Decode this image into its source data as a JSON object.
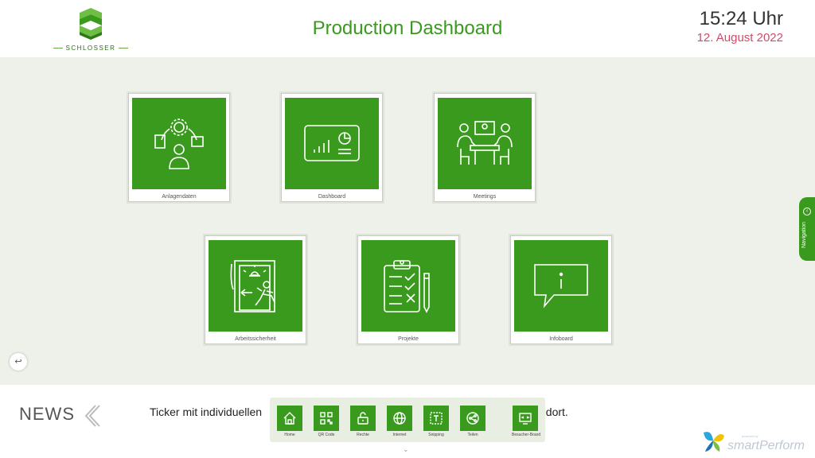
{
  "brand": {
    "name": "SCHLOSSER"
  },
  "header": {
    "title": "Production Dashboard",
    "time": "15:24 Uhr",
    "date": "12. August 2022"
  },
  "tiles": [
    {
      "label": "Anlagendaten",
      "icon": "asset-data-icon"
    },
    {
      "label": "Dashboard",
      "icon": "dashboard-chart-icon"
    },
    {
      "label": "Meetings",
      "icon": "meeting-icon"
    },
    {
      "label": "Arbeitssicherheit",
      "icon": "safety-exit-icon"
    },
    {
      "label": "Projekte",
      "icon": "clipboard-checklist-icon"
    },
    {
      "label": "Infoboard",
      "icon": "info-speech-bubble-icon"
    }
  ],
  "navigation": {
    "label": "Navigation"
  },
  "news": {
    "title": "NEWS",
    "ticker_left": "Ticker mit individuellen",
    "ticker_right": "ndort."
  },
  "dock": [
    {
      "label": "Home",
      "icon": "home-icon"
    },
    {
      "label": "QR Code",
      "icon": "qr-code-icon"
    },
    {
      "label": "Rechte",
      "icon": "unlock-icon"
    },
    {
      "label": "Internet",
      "icon": "globe-icon"
    },
    {
      "label": "Snipping",
      "icon": "snipping-icon"
    },
    {
      "label": "Teilen",
      "icon": "share-icon"
    },
    {
      "label": "Besucher-Board",
      "icon": "visitor-board-icon"
    }
  ],
  "footer_brand": {
    "name": "smartPerform",
    "tagline": "powered by"
  },
  "colors": {
    "accent": "#3a9a1d",
    "date": "#d04a6b",
    "background": "#eef1ea"
  }
}
